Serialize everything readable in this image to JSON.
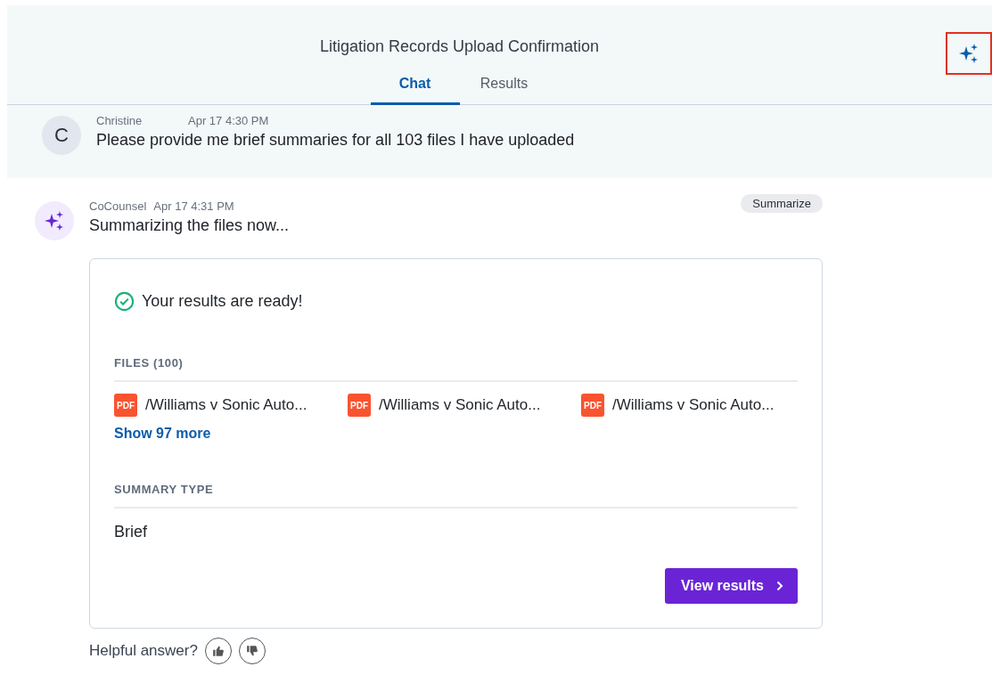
{
  "header": {
    "title": "Litigation Records Upload Confirmation",
    "assistant_button": {
      "highlighted": true
    }
  },
  "tabs": [
    {
      "label": "Chat",
      "selected": true
    },
    {
      "label": "Results",
      "selected": false
    }
  ],
  "messages": [
    {
      "kind": "user",
      "avatar": "C",
      "author": "Christine",
      "time": "Apr 17 4:30 PM",
      "text": "Please provide me brief summaries for all 103 files I have uploaded"
    },
    {
      "kind": "assistant",
      "author": "CoCounsel",
      "time": "Apr 17 4:31 PM",
      "tag": "Summarize",
      "text": "Summarizing the files now...",
      "result": {
        "status": "Your results are ready!",
        "files_heading": "FILES (100)",
        "files": [
          {
            "badge": "PDF",
            "name": "/Williams v Sonic Auto..."
          },
          {
            "badge": "PDF",
            "name": "/Williams v Sonic Auto..."
          },
          {
            "badge": "PDF",
            "name": "/Williams v Sonic Auto..."
          }
        ],
        "show_more": "Show 97 more",
        "summary_heading": "SUMMARY TYPE",
        "summary_value": "Brief",
        "button": "View results"
      },
      "feedback": "Helpful answer?"
    }
  ]
}
